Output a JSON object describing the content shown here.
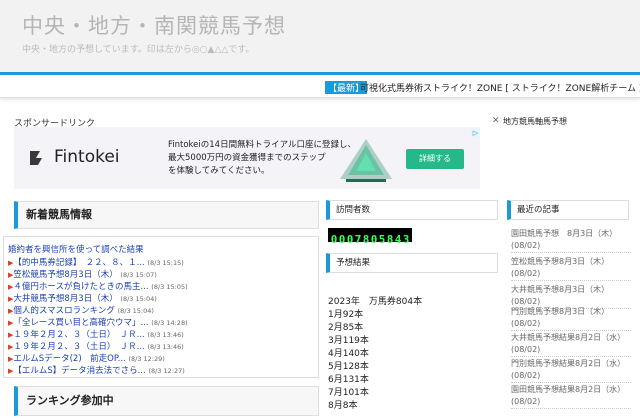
{
  "header": {
    "site_title": "中央・地方・南関競馬予想",
    "site_desc": "中央・地方の予想しています。印は左から◎○▲△△です。"
  },
  "news_bar": {
    "label": "【最新】",
    "text": "可視化式馬券術ストライク！ZONE [ ストライク！ZONE解析チーム ]"
  },
  "sponsor_label": "スポンサードリンク",
  "ad": {
    "logo": "Fintokei",
    "lines": [
      "Fintokeiの14日間無料トライアル口座に登録し、",
      "最大5000万円の資金獲得までのステップ",
      "を体験してみてください。"
    ],
    "button": "詳細する"
  },
  "right_top": {
    "close": "✕",
    "title": "地方競馬軸馬予想"
  },
  "news_section": {
    "title": "新着競馬情報",
    "items": [
      {
        "text": "婚約者を興信所を使って調べた結果",
        "date": "",
        "arrow": false
      },
      {
        "text": "【的中馬券記録】　２２、８、１...",
        "date": "(8/3 15:15)",
        "arrow": true
      },
      {
        "text": "笠松競馬予想8月3日（木）",
        "date": "(8/3 15:07)",
        "arrow": true
      },
      {
        "text": "４億円ホースが負けたときの馬主...",
        "date": "(8/3 15:05)",
        "arrow": true
      },
      {
        "text": "大井競馬予想8月3日（木）",
        "date": "(8/3 15:04)",
        "arrow": true
      },
      {
        "text": "個人的スマスロランキング",
        "date": "(8/3 15:04)",
        "arrow": true
      },
      {
        "text": "「全レース買い目と高確穴ウマ」...",
        "date": "(8/3 14:28)",
        "arrow": true
      },
      {
        "text": "１９年２月２、３（土日）　ＪＲ...",
        "date": "(8/3 13:46)",
        "arrow": true
      },
      {
        "text": "１９年２月２、３（土日）　ＪＲ...",
        "date": "(8/3 13:46)",
        "arrow": true
      },
      {
        "text": "エルムSデータ(2)　前走OP...",
        "date": "(8/3 12:29)",
        "arrow": true
      },
      {
        "text": "【エルムS】データ消去法でさら...",
        "date": "(8/3 12:27)",
        "arrow": true
      }
    ]
  },
  "ranking_title": "ランキング参加中",
  "visitors": {
    "title": "訪問者数",
    "count": "0007805843"
  },
  "results": {
    "title": "予想結果",
    "lines": [
      "2023年　万馬券804本",
      "1月92本",
      "2月85本",
      "3月119本",
      "4月140本",
      "5月128本",
      "6月131本",
      "7月101本",
      "8月8本"
    ]
  },
  "recent": {
    "title": "最近の記事",
    "items": [
      "園田競馬予想　8月3日（木） (08/02)",
      "笠松競馬予想8月3日（木） (08/02)",
      "大井競馬予想8月3日（木） (08/02)",
      "門別競馬予想8月3日（木） (08/02)",
      "大井競馬予想結果8月2日（水） (08/02)",
      "門別競馬予想結果8月2日（水） (08/02)",
      "園田競馬予想結果8月2日（水） (08/02)"
    ]
  }
}
